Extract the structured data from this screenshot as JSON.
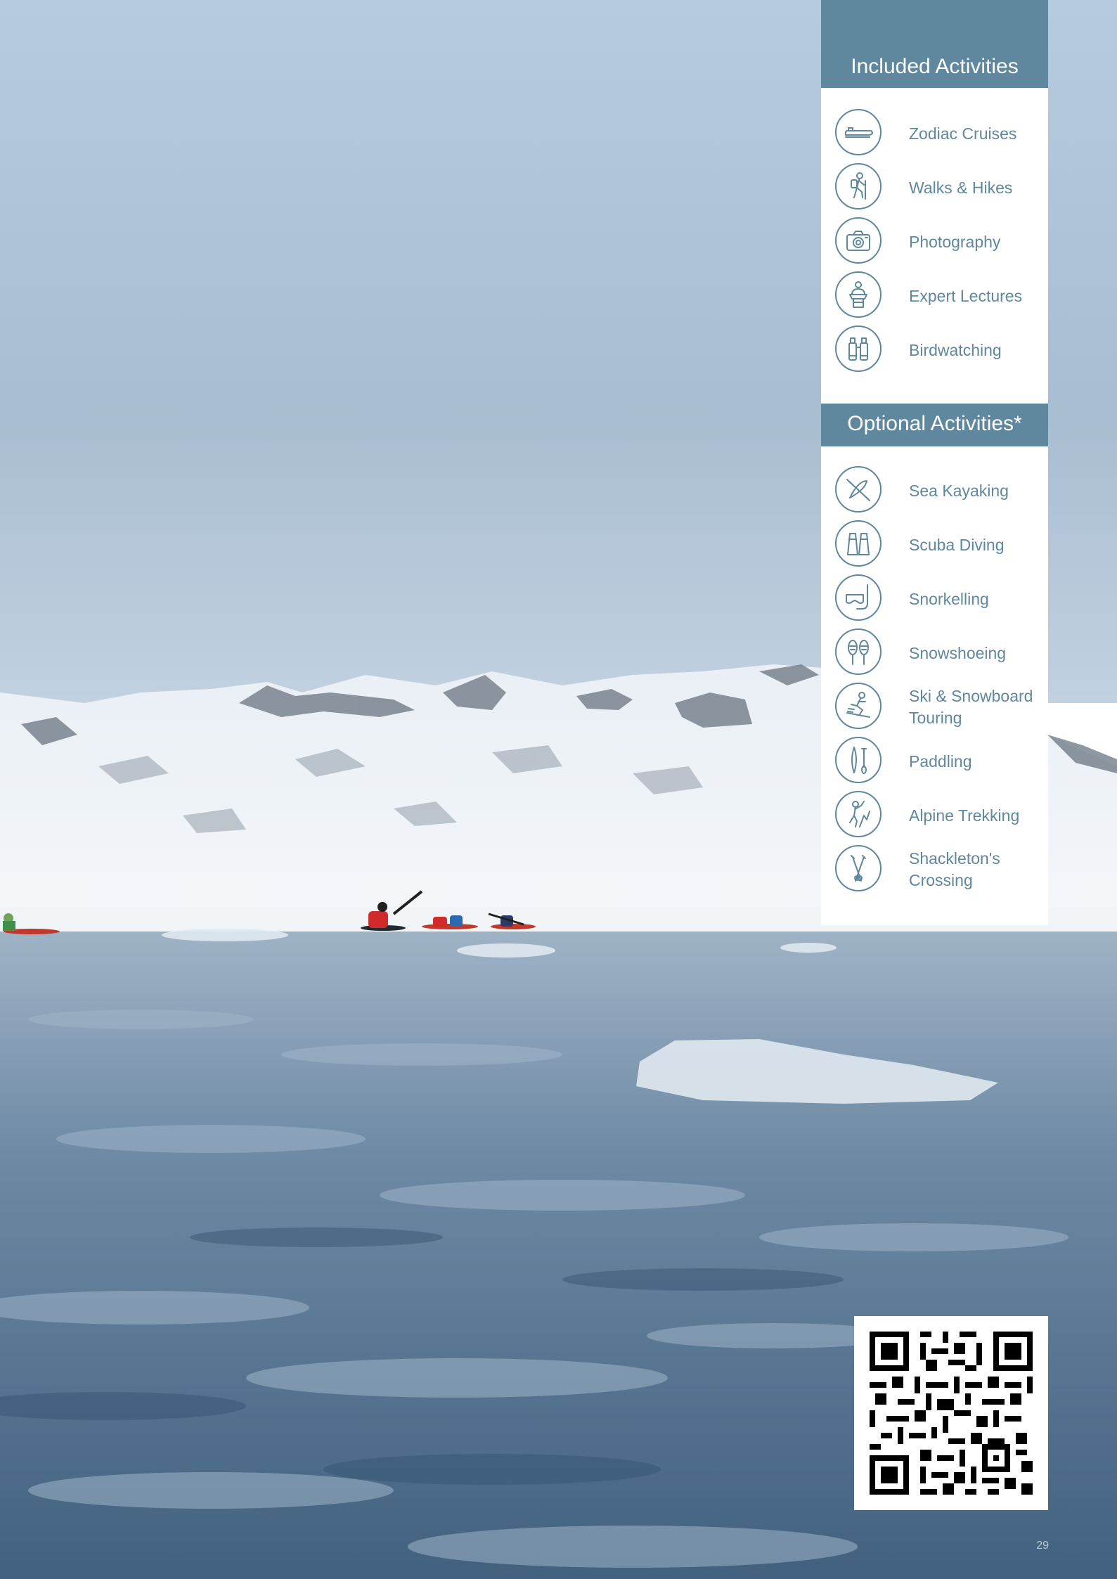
{
  "theme": {
    "accent": "#5f879e",
    "page_number_color": "#b8c7d4"
  },
  "included": {
    "heading": "Included Activities",
    "items": [
      {
        "label": "Zodiac Cruises",
        "icon": "zodiac-boat-icon"
      },
      {
        "label": "Walks & Hikes",
        "icon": "hiker-icon"
      },
      {
        "label": "Photography",
        "icon": "camera-icon"
      },
      {
        "label": "Expert Lectures",
        "icon": "lecturer-icon"
      },
      {
        "label": "Birdwatching",
        "icon": "binoculars-icon"
      }
    ]
  },
  "optional": {
    "heading": "Optional Activities*",
    "items": [
      {
        "label": "Sea Kayaking",
        "icon": "kayak-icon"
      },
      {
        "label": "Scuba Diving",
        "icon": "fins-icon"
      },
      {
        "label": "Snorkelling",
        "icon": "snorkel-icon"
      },
      {
        "label": "Snowshoeing",
        "icon": "snowshoes-icon"
      },
      {
        "label": "Ski & Snowboard Touring",
        "icon": "skier-icon"
      },
      {
        "label": "Paddling",
        "icon": "paddleboard-icon"
      },
      {
        "label": "Alpine Trekking",
        "icon": "climber-icon"
      },
      {
        "label": "Shackleton's Crossing",
        "icon": "ski-poles-icon"
      }
    ]
  },
  "qr_code": {
    "icon": "qr-code-icon"
  },
  "page_number": "29"
}
